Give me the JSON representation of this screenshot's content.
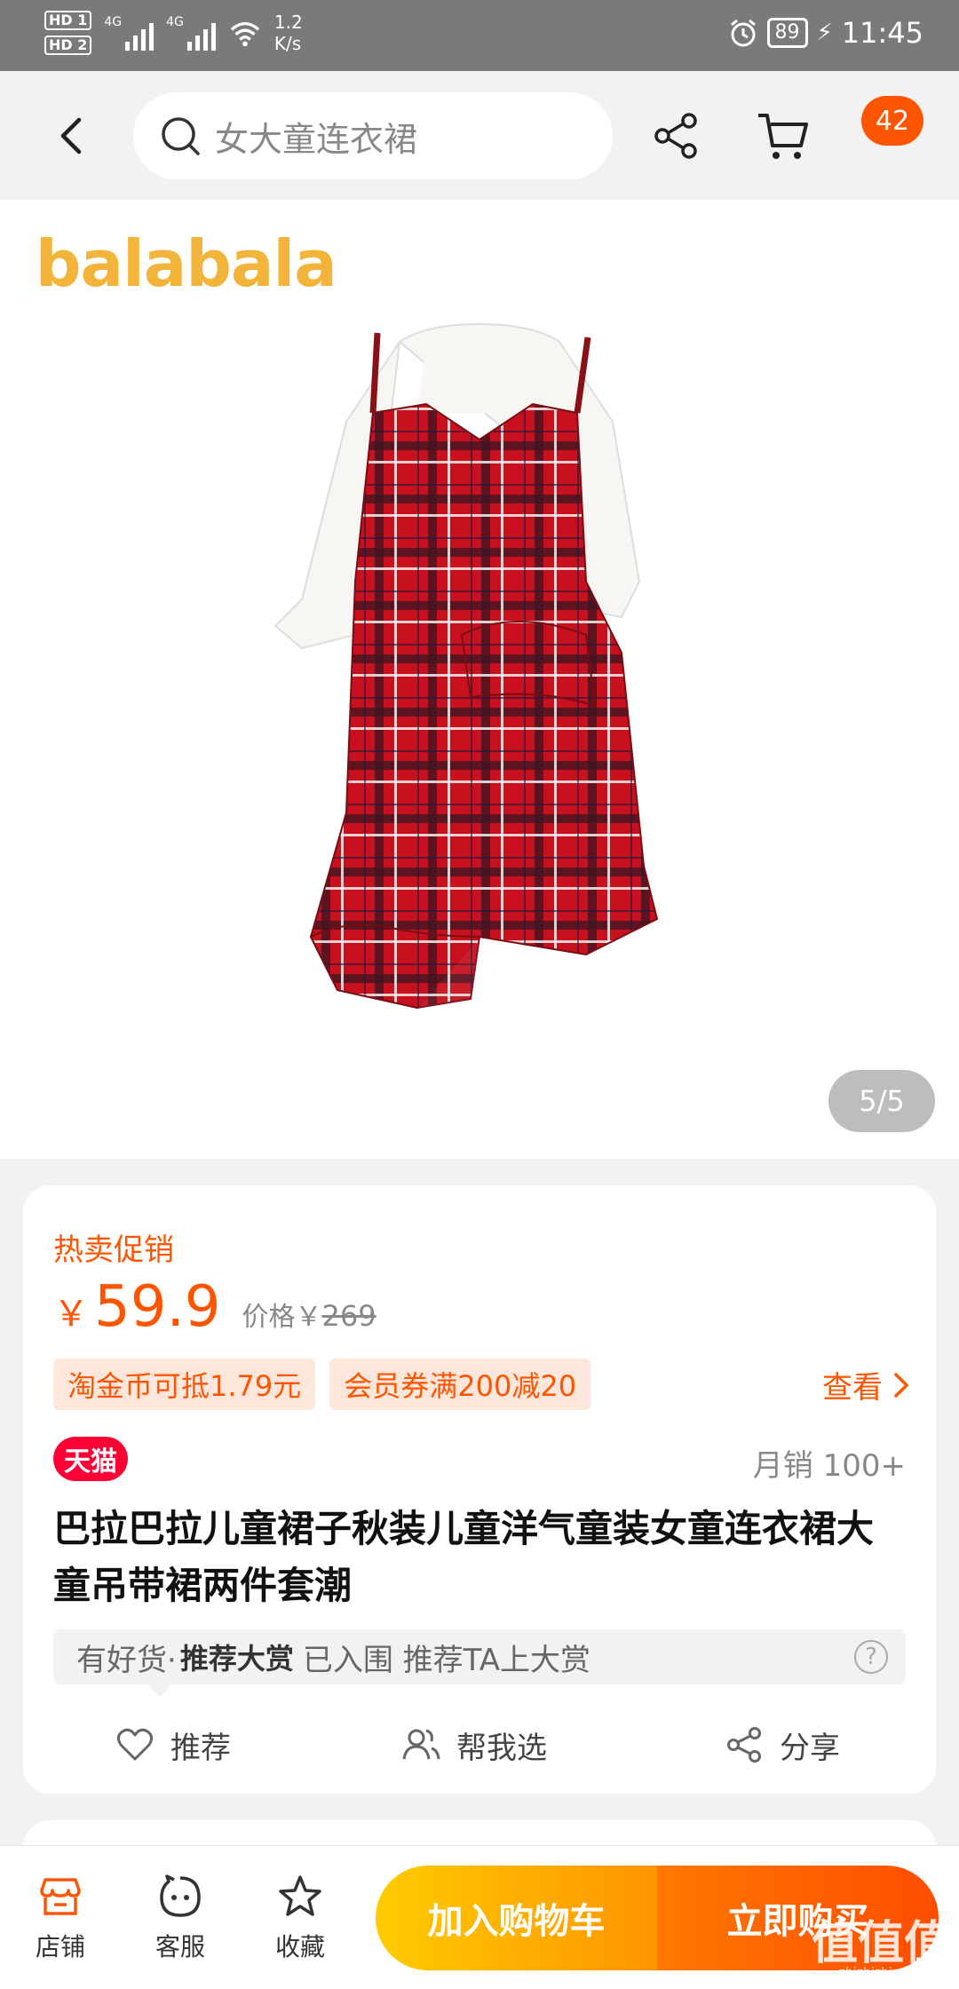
{
  "status_bar": {
    "hd1": "HD 1",
    "hd2": "HD 2",
    "net1": "4G",
    "net2": "4G",
    "speed_value": "1.2",
    "speed_unit": "K/s",
    "battery": "89",
    "time": "11:45"
  },
  "nav": {
    "search_placeholder": "女大童连衣裙",
    "cart_badge": "42"
  },
  "gallery": {
    "brand": "balabala",
    "pager": "5/5"
  },
  "product": {
    "promo_label": "热卖促销",
    "currency": "￥",
    "price": "59.9",
    "orig_label": "价格￥",
    "orig_price": "269",
    "tags": [
      "淘金币可抵1.79元",
      "会员券满200减20"
    ],
    "view_more": "查看",
    "platform": "天猫",
    "monthly_sales": "月销 100+",
    "title": "巴拉巴拉儿童裙子秋装儿童洋气童装女童连衣裙大童吊带裙两件套潮",
    "reco_prefix": "有好货·",
    "reco_highlight": "推荐大赏",
    "reco_text": "已入围 推荐TA上大赏",
    "reco_help": "?",
    "actions": {
      "recommend": "推荐",
      "help_choose": "帮我选",
      "share": "分享"
    }
  },
  "bottom_bar": {
    "shop": "店铺",
    "service": "客服",
    "favorite": "收藏",
    "add_to_cart": "加入购物车",
    "buy_now": "立即购买"
  },
  "watermark": {
    "text": "值值值",
    "domain": "zhizhizhi.com"
  },
  "colors": {
    "accent": "#ff5500",
    "tmall": "#ff0036",
    "brand": "#f2b43b",
    "cart_gradient_start": "#ffcb00",
    "buy_gradient_end": "#ff4d00"
  }
}
